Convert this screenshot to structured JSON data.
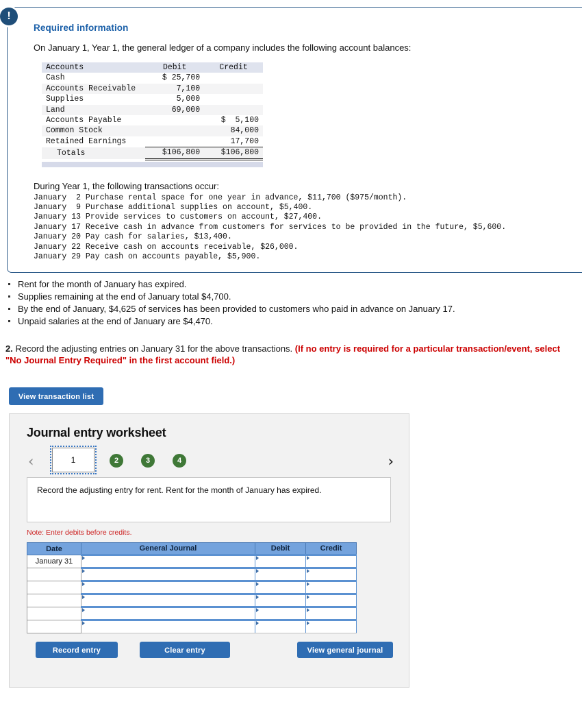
{
  "alert": {
    "icon": "exclamation-icon",
    "glyph": "!"
  },
  "required_info": {
    "title": "Required information",
    "lead": "On January 1, Year 1, the general ledger of a company includes the following account balances:"
  },
  "ledger": {
    "headers": [
      "Accounts",
      "Debit",
      "Credit"
    ],
    "rows": [
      {
        "account": "Cash",
        "debit": "$ 25,700",
        "credit": ""
      },
      {
        "account": "Accounts Receivable",
        "debit": "7,100",
        "credit": ""
      },
      {
        "account": "Supplies",
        "debit": "5,000",
        "credit": ""
      },
      {
        "account": "Land",
        "debit": "69,000",
        "credit": ""
      },
      {
        "account": "Accounts Payable",
        "debit": "",
        "credit": "$  5,100"
      },
      {
        "account": "Common Stock",
        "debit": "",
        "credit": "84,000"
      },
      {
        "account": "Retained Earnings",
        "debit": "",
        "credit": "17,700"
      }
    ],
    "totals": {
      "label": "Totals",
      "debit": "$106,800",
      "credit": "$106,800"
    }
  },
  "transactions": {
    "heading": "During Year 1, the following transactions occur:",
    "lines": [
      "January  2 Purchase rental space for one year in advance, $11,700 ($975/month).",
      "January  9 Purchase additional supplies on account, $5,400.",
      "January 13 Provide services to customers on account, $27,400.",
      "January 17 Receive cash in advance from customers for services to be provided in the future, $5,600.",
      "January 20 Pay cash for salaries, $13,400.",
      "January 22 Receive cash on accounts receivable, $26,000.",
      "January 29 Pay cash on accounts payable, $5,900."
    ]
  },
  "adjustments": [
    "Rent for the month of January has expired.",
    "Supplies remaining at the end of January total $4,700.",
    "By the end of January, $4,625 of services has been provided to customers who paid in advance on January 17.",
    "Unpaid salaries at the end of January are $4,470."
  ],
  "question": {
    "number": "2.",
    "text": "Record the adjusting entries on January 31 for the above transactions.",
    "hint": "(If no entry is required for a particular transaction/event, select \"No Journal Entry Required\" in the first account field.)"
  },
  "toolbar": {
    "view_transaction_list": "View transaction list"
  },
  "worksheet": {
    "title": "Journal entry worksheet",
    "pager": {
      "prev_icon": "chevron-left-icon",
      "next_icon": "chevron-right-icon",
      "active_tab": "1",
      "dots": [
        "2",
        "3",
        "4"
      ]
    },
    "prompt": "Record the adjusting entry for rent. Rent for the month of January has expired.",
    "note": "Note: Enter debits before credits.",
    "table": {
      "headers": [
        "Date",
        "General Journal",
        "Debit",
        "Credit"
      ],
      "rows": [
        {
          "date": "January 31",
          "general_journal": "",
          "debit": "",
          "credit": ""
        },
        {
          "date": "",
          "general_journal": "",
          "debit": "",
          "credit": ""
        },
        {
          "date": "",
          "general_journal": "",
          "debit": "",
          "credit": ""
        },
        {
          "date": "",
          "general_journal": "",
          "debit": "",
          "credit": ""
        },
        {
          "date": "",
          "general_journal": "",
          "debit": "",
          "credit": ""
        },
        {
          "date": "",
          "general_journal": "",
          "debit": "",
          "credit": ""
        }
      ]
    },
    "buttons": {
      "record_entry": "Record entry",
      "clear_entry": "Clear entry",
      "view_general_journal": "View general journal"
    }
  },
  "colors": {
    "accent_blue": "#2f6db3",
    "alert_navy": "#1f4e79",
    "header_blue": "#74a3dd",
    "dot_green": "#3f7837",
    "red": "#cc0000",
    "title_blue": "#1a5fa8"
  }
}
